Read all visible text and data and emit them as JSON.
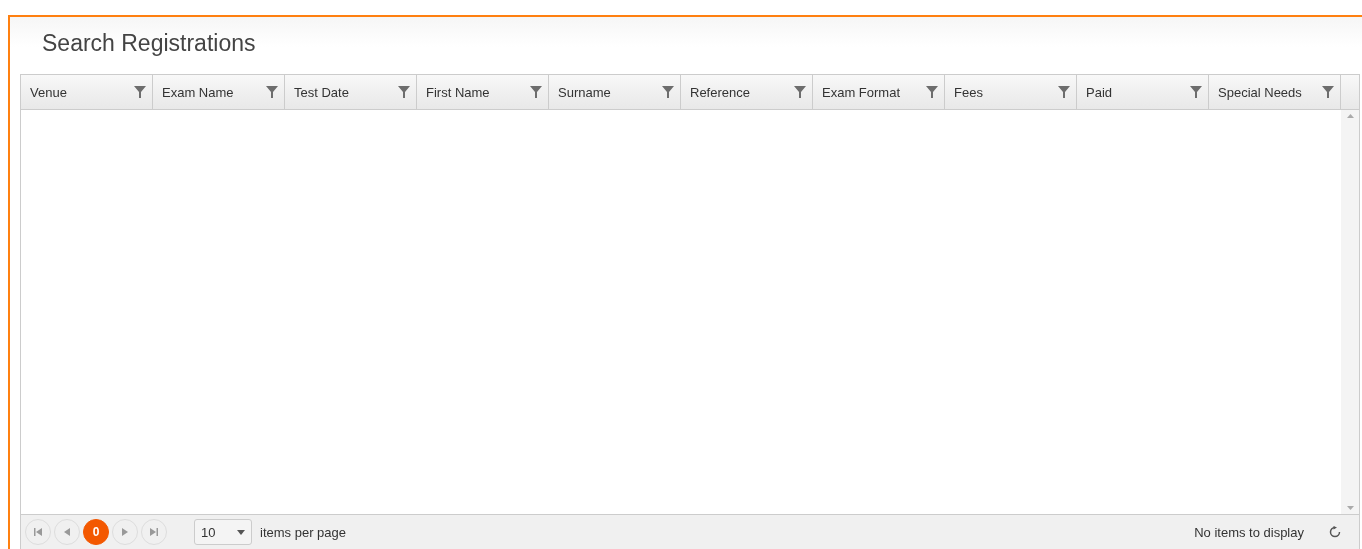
{
  "title": "Search Registrations",
  "columns": [
    {
      "label": "Venue"
    },
    {
      "label": "Exam Name"
    },
    {
      "label": "Test Date"
    },
    {
      "label": "First Name"
    },
    {
      "label": "Surname"
    },
    {
      "label": "Reference"
    },
    {
      "label": "Exam Format"
    },
    {
      "label": "Fees"
    },
    {
      "label": "Paid"
    },
    {
      "label": "Special Needs"
    }
  ],
  "pager": {
    "pages": [
      {
        "label": "0",
        "selected": true
      }
    ],
    "page_size": "10",
    "page_size_label": "items per page",
    "status": "No items to display"
  }
}
